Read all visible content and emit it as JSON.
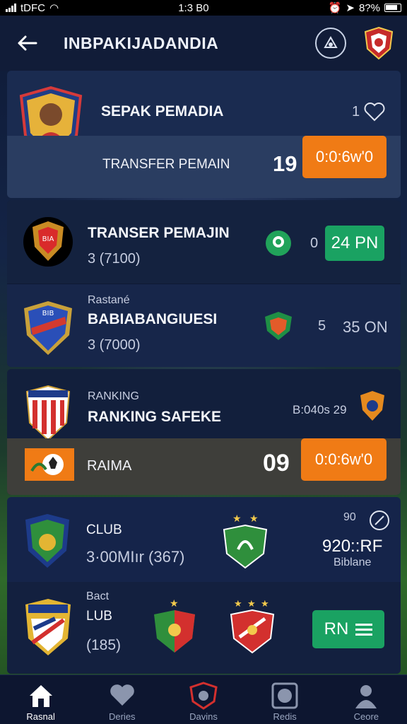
{
  "status": {
    "carrier": "tDFC",
    "time": "1:3 B0",
    "battery": "8?%"
  },
  "header": {
    "title": "INBPAKIJADANDIA"
  },
  "featured": {
    "title": "SEPAK PEMADIA",
    "likes": "1",
    "subtitle": "TRANSFER PEMAIN",
    "number": "19",
    "button": "0:0:6w'0"
  },
  "list": [
    {
      "title": "TRANSER PEMAJIN",
      "meta": "3 (7100)",
      "count": "0",
      "button": "24 PN"
    },
    {
      "label": "Rastané",
      "title": "BABIABANGIUESI",
      "meta": "3 (7000)",
      "count": "5",
      "value": "35 ON"
    }
  ],
  "ranking": {
    "label": "RANKING",
    "title": "RANKING SAFEKE",
    "meta": "B:040s 29",
    "row_title": "RAIMA",
    "number": "09",
    "button": "0:0:6w'0"
  },
  "clubs": [
    {
      "title": "CLUB",
      "meta": "3·00MIır (367)",
      "score": "920::RF",
      "note": "Biblane",
      "top": "90"
    },
    {
      "label": "Bact",
      "title": "LUB",
      "meta": "(185)",
      "button": "RN"
    }
  ],
  "nav": [
    {
      "label": "Rasnal",
      "icon": "home-icon"
    },
    {
      "label": "Deries",
      "icon": "heart-icon"
    },
    {
      "label": "Davins",
      "icon": "crest-icon"
    },
    {
      "label": "Redis",
      "icon": "ball-icon"
    },
    {
      "label": "Ceore",
      "icon": "person-icon"
    }
  ],
  "colors": {
    "orange": "#f07b15",
    "green": "#1aa262",
    "navy": "#111c38"
  }
}
